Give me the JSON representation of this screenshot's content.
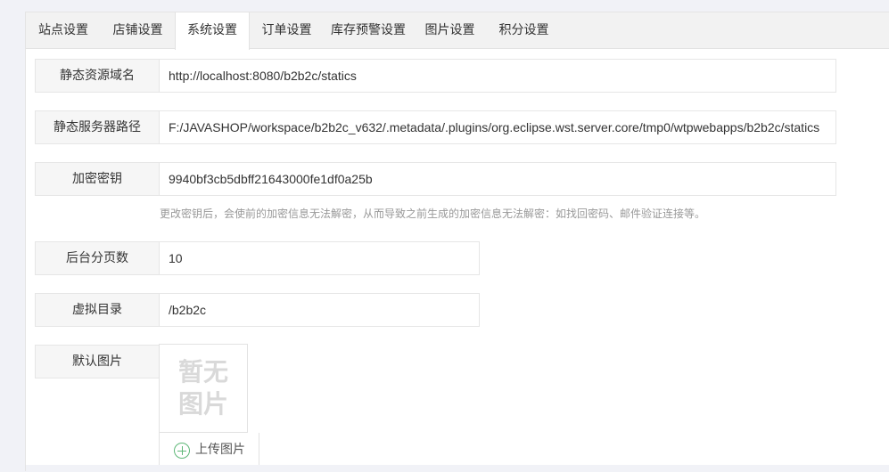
{
  "tabs": [
    {
      "label": "站点设置",
      "active": false
    },
    {
      "label": "店铺设置",
      "active": false
    },
    {
      "label": "系统设置",
      "active": true
    },
    {
      "label": "订单设置",
      "active": false
    },
    {
      "label": "库存预警设置",
      "active": false
    },
    {
      "label": "图片设置",
      "active": false
    },
    {
      "label": "积分设置",
      "active": false
    }
  ],
  "form": {
    "static_domain": {
      "label": "静态资源域名",
      "value": "http://localhost:8080/b2b2c/statics"
    },
    "static_path": {
      "label": "静态服务器路径",
      "value": "F:/JAVASHOP/workspace/b2b2c_v632/.metadata/.plugins/org.eclipse.wst.server.core/tmp0/wtpwebapps/b2b2c/statics"
    },
    "secret_key": {
      "label": "加密密钥",
      "value": "9940bf3cb5dbff21643000fe1df0a25b",
      "hint": "更改密钥后，会使前的加密信息无法解密，从而导致之前生成的加密信息无法解密：如找回密码、邮件验证连接等。"
    },
    "page_size": {
      "label": "后台分页数",
      "value": "10"
    },
    "virtual_dir": {
      "label": "虚拟目录",
      "value": "/b2b2c"
    },
    "default_image": {
      "label": "默认图片",
      "placeholder_text": [
        "暂无",
        "图片"
      ],
      "upload_label": "上传图片"
    }
  },
  "colors": {
    "accent_green": "#5fb878",
    "border": "#e6e6e6",
    "label_bg": "#f6f6f6",
    "page_bg": "#f1f2f7"
  }
}
